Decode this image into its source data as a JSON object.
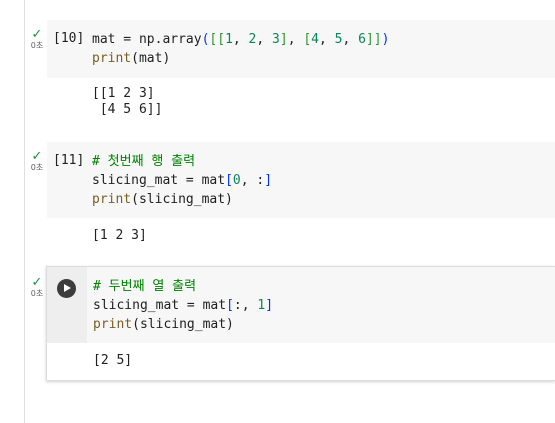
{
  "cells": [
    {
      "status_check": "✓",
      "status_time": "0초",
      "exec_count": "[10]",
      "code_lines": [
        "mat = np.array([[1, 2, 3], [4, 5, 6]])",
        "print(mat)"
      ],
      "output_lines": [
        "[[1 2 3]",
        " [4 5 6]]"
      ]
    },
    {
      "status_check": "✓",
      "status_time": "0초",
      "exec_count": "[11]",
      "code_lines": [
        "# 첫번째 행 출력",
        "slicing_mat = mat[0, :]",
        "print(slicing_mat)"
      ],
      "output_lines": [
        "[1 2 3]"
      ]
    },
    {
      "status_check": "✓",
      "status_time": "0초",
      "run_icon": "play-circle-icon",
      "code_lines": [
        "# 두번째 열 출력",
        "slicing_mat = mat[:, 1]",
        "print(slicing_mat)"
      ],
      "output_lines": [
        "[2 5]"
      ]
    }
  ],
  "colors": {
    "success": "#1e8e3e",
    "code_bg": "#f7f7f7",
    "builtin": "#795e26",
    "number": "#098658",
    "comment": "#008000"
  }
}
